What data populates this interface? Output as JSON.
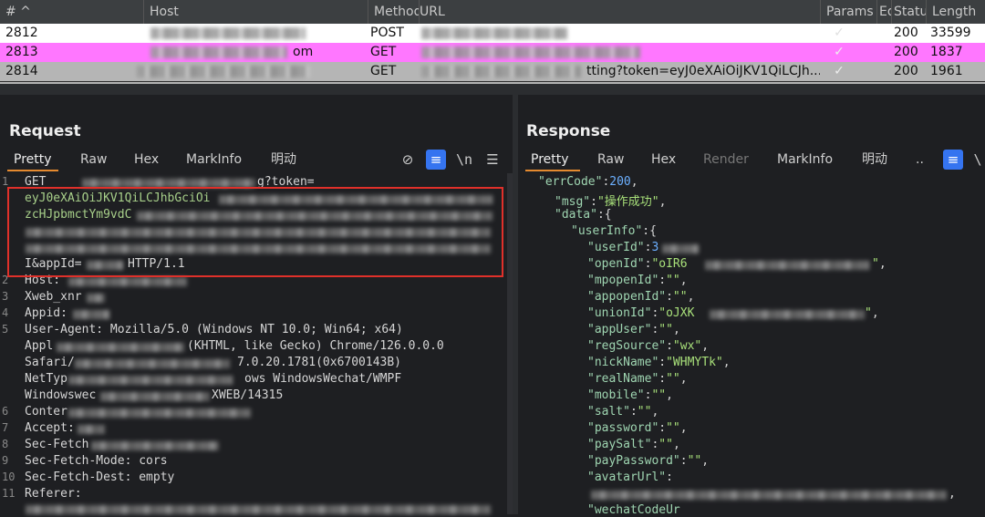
{
  "table": {
    "headers": [
      "# ^",
      "Host",
      "Method",
      "URL",
      "Params",
      "Ed",
      "Status",
      "Length"
    ],
    "rows": [
      {
        "num": "2812",
        "host_tail": "",
        "method": "POST",
        "url_tail": "",
        "params": "",
        "status": "200",
        "length": "33599",
        "bg": "#ffffff"
      },
      {
        "num": "2813",
        "host_tail": "om",
        "method": "GET",
        "url_tail": "",
        "params": "✓",
        "status": "200",
        "length": "1837",
        "bg": "#ff77ff"
      },
      {
        "num": "2814",
        "host_tail": "",
        "method": "GET",
        "url_tail": "tting?token=eyJ0eXAiOiJKV1QiLCJh...",
        "params": "✓",
        "status": "200",
        "length": "1961",
        "bg": "#b5b5b5"
      }
    ]
  },
  "request": {
    "title": "Request",
    "tabs": [
      "Pretty",
      "Raw",
      "Hex",
      "MarkInfo",
      "明动"
    ],
    "lines": {
      "l1a": "GET",
      "l1b": "g?token=",
      "l1c": "eyJ0eXAiOiJKV1QiLCJhbGciOi",
      "l1d": "zcHJpbmctYm9vdC",
      "l1e": "I&appId=",
      "l1f": "HTTP/1.1",
      "l2": "Host:",
      "l3": "Xweb_xnr",
      "l4": "Appid:",
      "l5a": "User-Agent: Mozilla/5.0 (Windows NT 10.0; Win64; x64)",
      "l5b": "(KHTML, like Gecko) Chrome/126.0.0.0",
      "l5c": "7.0.20.1781(0x6700143B)",
      "l5d": "ows WindowsWechat/WMPF",
      "l5e": "XWEB/14315",
      "l6": "Conter",
      "l7": "Accept:",
      "l8": "Sec-Fetch",
      "l9": "Sec-Fetch-Mode: cors",
      "l10": "Sec-Fetch-Dest: empty",
      "l11": "Referer:",
      "l5b_pre": "Appl",
      "l5c_pre": "Safari/",
      "l5d_pre": "NetTyp",
      "l5e_pre": "Windowswec"
    },
    "line_numbers": [
      "1",
      "2",
      "3",
      "4",
      "5",
      "6",
      "7",
      "8",
      "9",
      "10",
      "11"
    ]
  },
  "response": {
    "title": "Response",
    "tabs": [
      "Pretty",
      "Raw",
      "Hex",
      "Render",
      "MarkInfo",
      "明动",
      ".."
    ],
    "json": {
      "errCode_key": "\"errCode\"",
      "errCode_val": "200",
      "msg_key": "\"msg\"",
      "msg_val": "\"操作成功\"",
      "data_key": "\"data\"",
      "userInfo_key": "\"userInfo\"",
      "userId_key": "\"userId\"",
      "userId_val": "3",
      "openId_key": "\"openId\"",
      "openId_val": "\"oIR6",
      "mpopenId_key": "\"mpopenId\"",
      "appopenId_key": "\"appopenId\"",
      "unionId_key": "\"unionId\"",
      "unionId_val": "\"oJXK",
      "appUser_key": "\"appUser\"",
      "regSource_key": "\"regSource\"",
      "regSource_val": "\"wx\"",
      "nickName_key": "\"nickName\"",
      "nickName_val": "\"WHMYTk\"",
      "realName_key": "\"realName\"",
      "mobile_key": "\"mobile\"",
      "salt_key": "\"salt\"",
      "password_key": "\"password\"",
      "paySalt_key": "\"paySalt\"",
      "payPassword_key": "\"payPassword\"",
      "avatarUrl_key": "\"avatarUrl\"",
      "wechatCode_key": "\"wechatCodeUr",
      "empty_str": "\"\""
    }
  }
}
